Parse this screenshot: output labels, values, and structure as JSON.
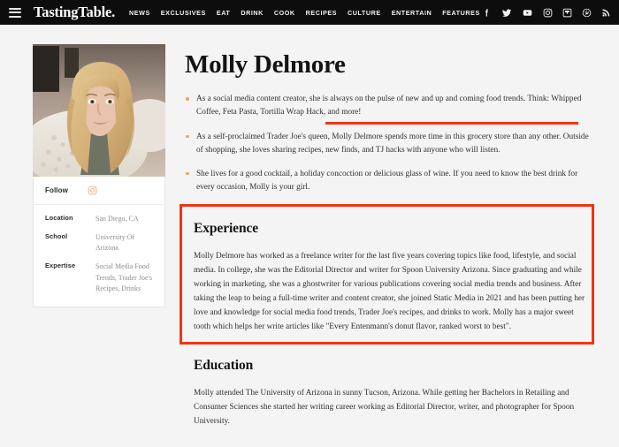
{
  "nav": {
    "menu_icon": "hamburger-menu-icon",
    "brand": "TastingTable.",
    "links": [
      "NEWS",
      "EXCLUSIVES",
      "EAT",
      "DRINK",
      "COOK",
      "RECIPES",
      "CULTURE",
      "ENTERTAIN",
      "FEATURES"
    ],
    "social": [
      {
        "name": "facebook-icon",
        "label": "Facebook"
      },
      {
        "name": "twitter-icon",
        "label": "Twitter"
      },
      {
        "name": "youtube-icon",
        "label": "YouTube"
      },
      {
        "name": "instagram-icon",
        "label": "Instagram"
      },
      {
        "name": "flipboard-icon",
        "label": "Flipboard"
      },
      {
        "name": "pinterest-icon",
        "label": "Pinterest"
      },
      {
        "name": "rss-icon",
        "label": "RSS"
      }
    ]
  },
  "sidebar": {
    "photo_alt": "Molly Delmore profile photo",
    "follow_label": "Follow",
    "follow_icon": "instagram-icon",
    "meta": [
      {
        "key": "Location",
        "value": "San Diego, CA"
      },
      {
        "key": "School",
        "value": "University Of Arizona"
      },
      {
        "key": "Expertise",
        "value": "Social Media Food Trends, Trader Joe's Recipes, Drinks"
      }
    ]
  },
  "main": {
    "title": "Molly Delmore",
    "bullets": [
      "As a social media content creator, she is always on the pulse of new and up and coming food trends. Think: Whipped Coffee, Feta Pasta, Tortilla Wrap Hack, and more!",
      "As a self-proclaimed Trader Joe's queen, Molly Delmore spends more time in this grocery store than any other. Outside of shopping, she loves sharing recipes, new finds, and TJ hacks with anyone who will listen.",
      "She lives for a good cocktail, a holiday concoction or delicious glass of wine. If you need to know the best drink for every occasion, Molly is your girl."
    ],
    "experience": {
      "title": "Experience",
      "body": "Molly Delmore has worked as a freelance writer for the last five years covering topics like food, lifestyle, and social media. In college, she was the Editorial Director and writer for Spoon University Arizona. Since graduating and while working in marketing, she was a ghostwriter for various publications covering social media trends and business. After taking the leap to being a full-time writer and content creator, she joined Static Media in 2021 and has been putting her love and knowledge for social media food trends, Trader Joe's recipes, and drinks to work. Molly has a major sweet tooth which helps her write articles like \"Every Entenmann's donut flavor, ranked worst to best\"."
    },
    "education": {
      "title": "Education",
      "body": "Molly attended The University of Arizona in sunny Tucson, Arizona. While getting her Bachelors in Retailing and Consumer Sciences she started her writing career working as Editorial Director, writer, and photographer for Spoon University."
    }
  },
  "annotations": {
    "highlight_color": "#f03515",
    "underline_target": "she is always on the pulse of new and up and coming food trends.",
    "box_target": "Experience"
  },
  "colors": {
    "nav_background": "#0d0d0d",
    "page_background": "#f4f4f4",
    "card_background": "#ffffff",
    "bullet_marker": "#e8a95c",
    "annotation_red": "#f03515",
    "instagram_accent": "#e8b68a"
  }
}
